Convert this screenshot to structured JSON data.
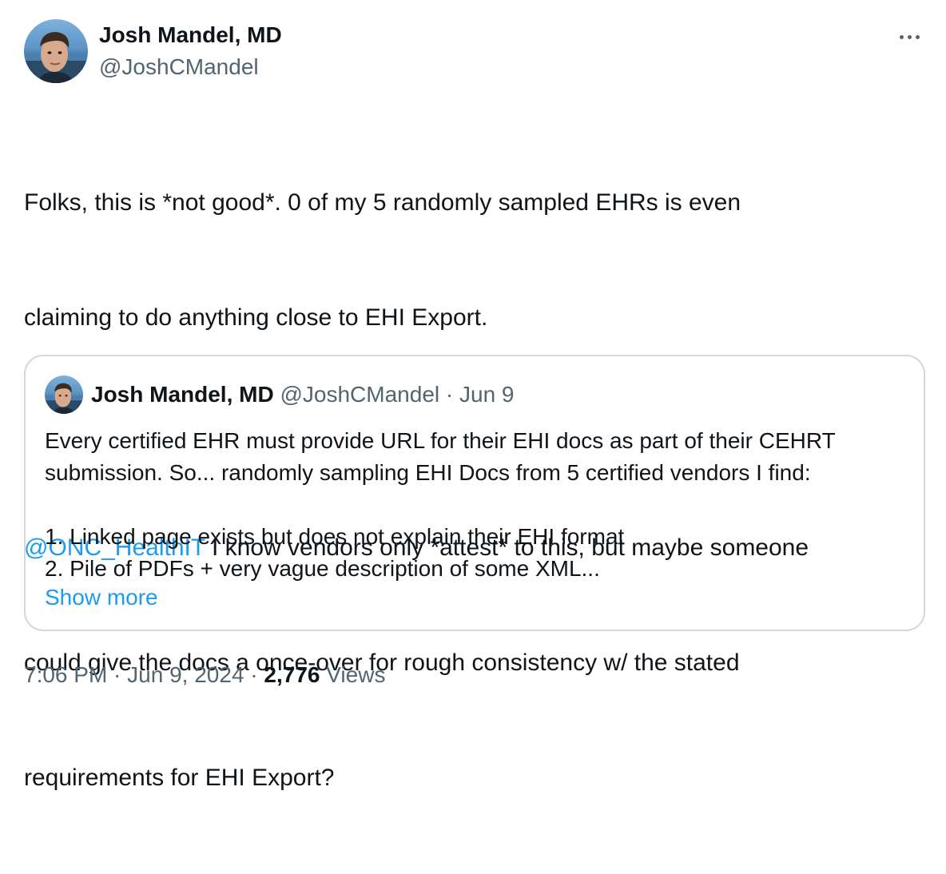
{
  "author": {
    "name": "Josh Mandel, MD",
    "handle": "@JoshCMandel",
    "avatar_icon": "profile-photo"
  },
  "more_icon": "more-horizontal-icon",
  "tweet": {
    "paragraph1_line1": "Folks, this is *not good*. 0 of my 5 randomly sampled EHRs is even",
    "paragraph1_line2": "claiming to do anything close to EHI Export.",
    "mention": "@ONC_HealthIT",
    "paragraph2_line1_rest": " I know vendors only *attest* to this, but maybe someone",
    "paragraph2_line2": "could give the docs a once-over for rough consistency w/ the stated",
    "paragraph2_line3": "requirements for EHI Export?"
  },
  "quote": {
    "name": "Josh Mandel, MD",
    "handle": "@JoshCMandel",
    "separator": " · ",
    "date": "Jun 9",
    "line1": "Every certified EHR must provide URL for their EHI docs as part of their CEHRT",
    "line2": "submission. So... randomly sampling EHI Docs from 5 certified vendors I find:",
    "line3": "1. Linked page exists but does not explain their EHI format",
    "line4": "2. Pile of PDFs + very vague description of some XML...",
    "show_more": "Show more"
  },
  "footer": {
    "time": "7:06 PM",
    "dot1": " · ",
    "date": "Jun 9, 2024",
    "dot2": " · ",
    "views_count": "2,776",
    "views_label": " Views"
  },
  "colors": {
    "text": "#0f1419",
    "secondary": "#536471",
    "link": "#1d9bf0",
    "border": "#cfd9de"
  }
}
